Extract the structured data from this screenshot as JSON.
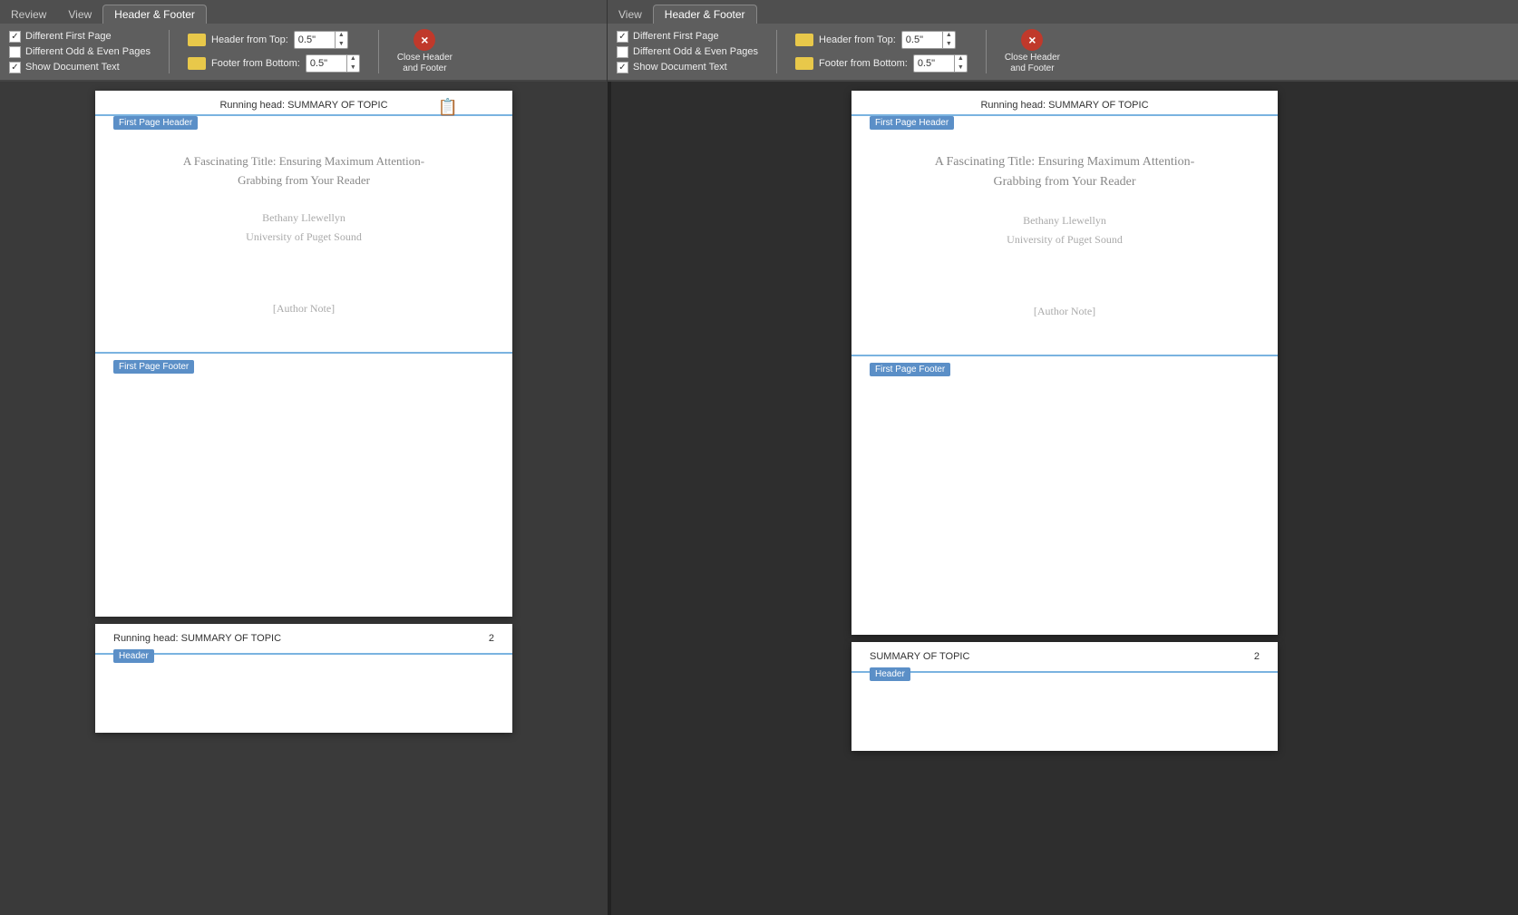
{
  "left_panel": {
    "tabs": [
      {
        "label": "Review",
        "active": false
      },
      {
        "label": "View",
        "active": false
      },
      {
        "label": "Header & Footer",
        "active": true
      }
    ],
    "ribbon": {
      "checkboxes": [
        {
          "label": "Different First Page",
          "checked": true
        },
        {
          "label": "Different Odd & Even Pages",
          "checked": false
        },
        {
          "label": "Show Document Text",
          "checked": true
        }
      ],
      "spinners": [
        {
          "icon": "header-icon",
          "label": "Header from Top:",
          "value": "0.5\""
        },
        {
          "icon": "footer-icon",
          "label": "Footer from Bottom:",
          "value": "0.5\""
        }
      ],
      "close_button": {
        "label": "Close Header\nand Footer",
        "icon": "×"
      }
    },
    "page1": {
      "header_text": "Running head: SUMMARY OF TOPIC",
      "header_label": "First Page Header",
      "title_line1": "A Fascinating Title: Ensuring Maximum Attention-",
      "title_line2": "Grabbing from Your Reader",
      "author": "Bethany Llewellyn",
      "institution": "University of Puget Sound",
      "author_note": "[Author Note]",
      "footer_label": "First Page Footer"
    },
    "page2": {
      "header_text": "Running head: SUMMARY OF TOPIC",
      "page_number": "2",
      "header_label": "Header"
    }
  },
  "right_panel": {
    "tabs": [
      {
        "label": "View",
        "active": false
      },
      {
        "label": "Header & Footer",
        "active": true
      }
    ],
    "ribbon": {
      "checkboxes": [
        {
          "label": "Different First Page",
          "checked": true
        },
        {
          "label": "Different Odd & Even Pages",
          "checked": false
        },
        {
          "label": "Show Document Text",
          "checked": true
        }
      ],
      "spinners": [
        {
          "icon": "header-icon",
          "label": "Header from Top:",
          "value": "0.5\""
        },
        {
          "icon": "footer-icon",
          "label": "Footer from Bottom:",
          "value": "0.5\""
        }
      ],
      "close_button": {
        "label": "Close Header\nand Footer",
        "icon": "×"
      }
    },
    "page1": {
      "header_text": "Running head: SUMMARY OF TOPIC",
      "header_label": "First Page Header",
      "title_line1": "A Fascinating Title: Ensuring Maximum Attention-",
      "title_line2": "Grabbing from Your Reader",
      "author": "Bethany Llewellyn",
      "institution": "University of Puget Sound",
      "author_note": "[Author Note]",
      "footer_label": "First Page Footer"
    },
    "page2": {
      "header_text": "SUMMARY OF TOPIC",
      "page_number": "2",
      "header_label": "Header"
    }
  }
}
